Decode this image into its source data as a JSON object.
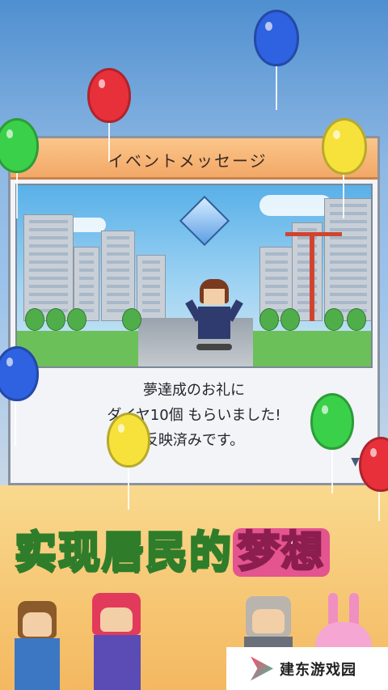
{
  "dialog": {
    "title": "イベントメッセージ",
    "message_lines": [
      "夢達成のお礼に",
      "ダイヤ10個 もらいました!",
      "反映済みです。"
    ],
    "arrow": "▼"
  },
  "slogan": {
    "part1": "实现居民的",
    "part2": "梦想"
  },
  "watermark": {
    "text": "建东游戏园"
  },
  "colors": {
    "balloon_red": "#e8303a",
    "balloon_blue": "#2f62e0",
    "balloon_green": "#3bd04a",
    "balloon_yellow": "#f6e23a",
    "header": "#f2a867",
    "slogan_green": "#2f7d2a",
    "slogan_pink": "#e4548f"
  }
}
